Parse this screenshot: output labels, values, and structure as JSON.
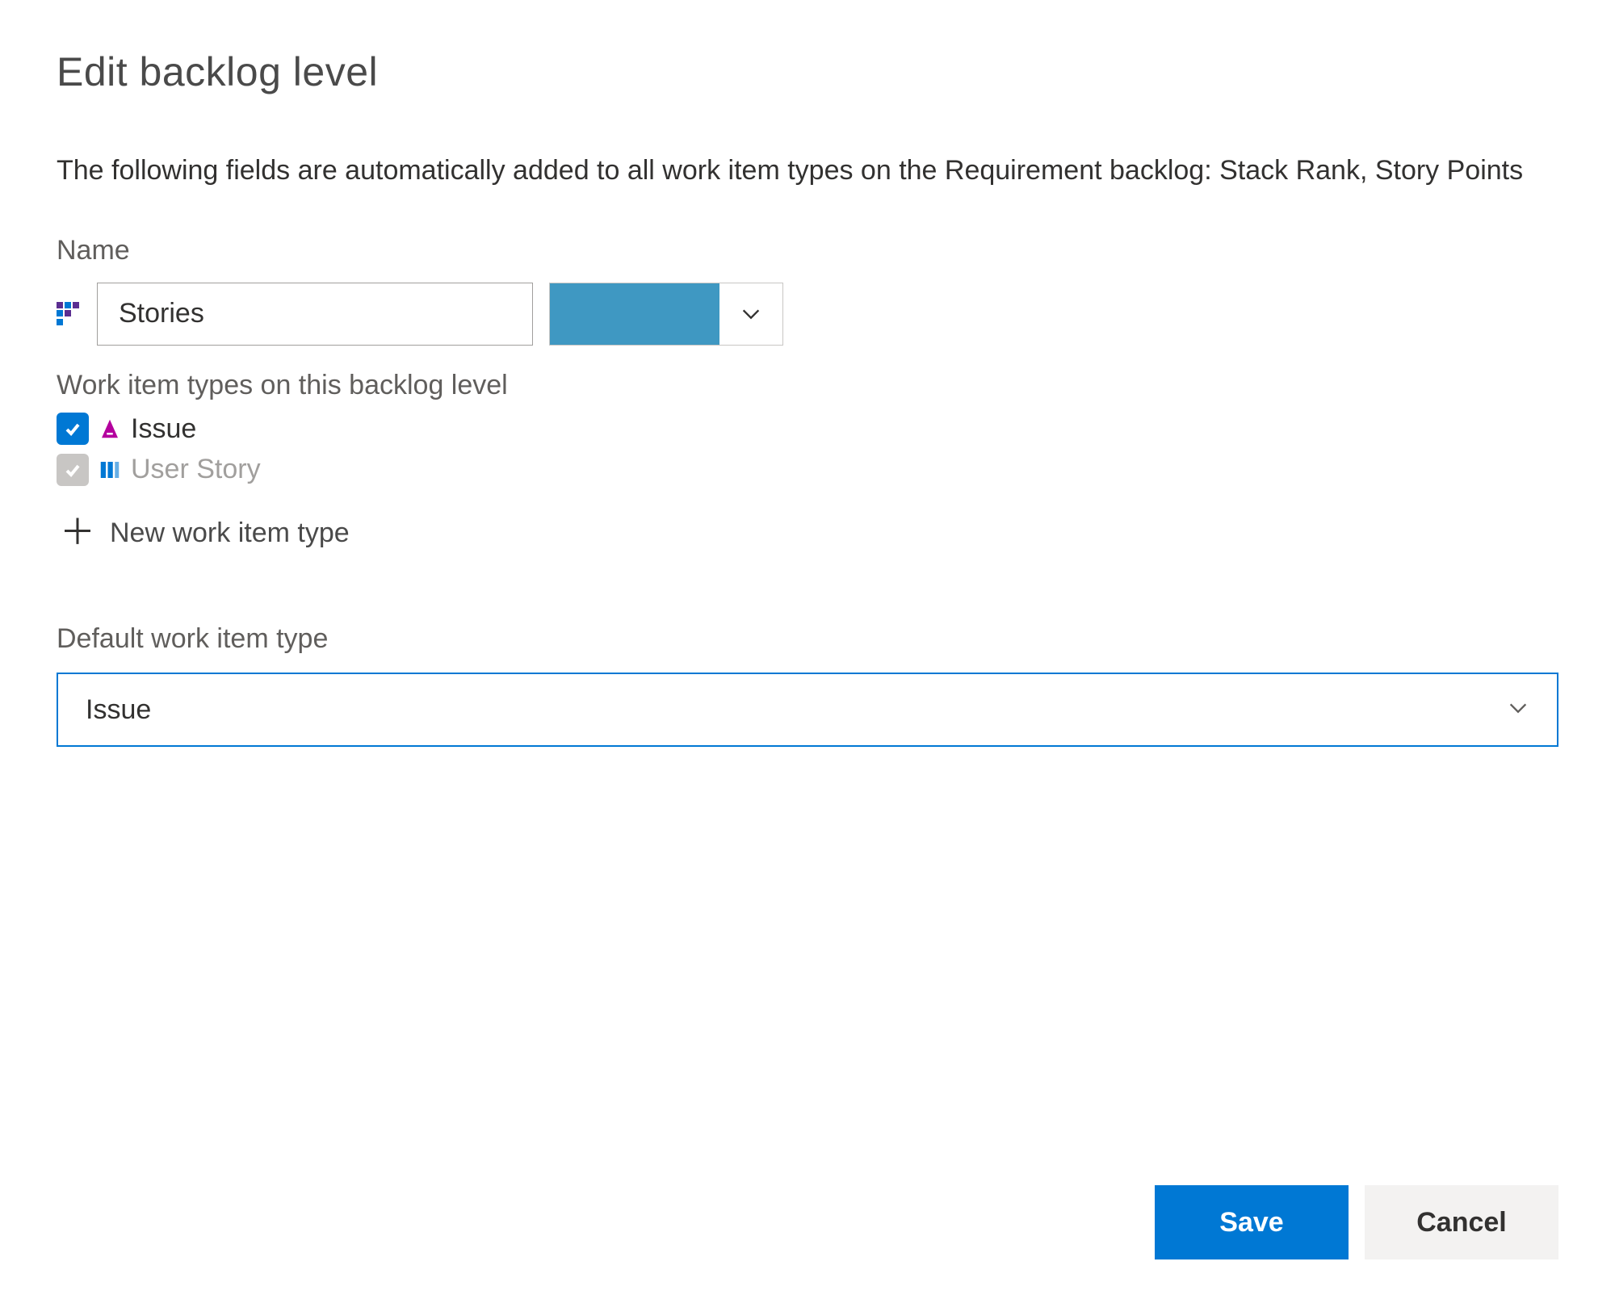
{
  "header": {
    "title": "Edit backlog level"
  },
  "description": "The following fields are automatically added to all work item types on the Requirement backlog: Stack Rank, Story Points",
  "name": {
    "label": "Name",
    "value": "Stories",
    "color": "#3f98c2"
  },
  "workItemTypes": {
    "label": "Work item types on this backlog level",
    "items": [
      {
        "name": "Issue",
        "checked": true,
        "enabled": true,
        "icon": "issue"
      },
      {
        "name": "User Story",
        "checked": true,
        "enabled": false,
        "icon": "user-story"
      }
    ],
    "newLabel": "New work item type"
  },
  "defaultType": {
    "label": "Default work item type",
    "value": "Issue"
  },
  "buttons": {
    "save": "Save",
    "cancel": "Cancel"
  }
}
